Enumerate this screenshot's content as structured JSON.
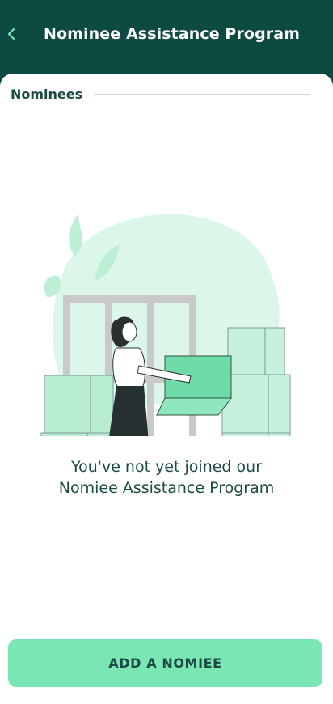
{
  "header": {
    "title": "Nominee Assistance Program",
    "back_icon": "chevron-left-icon"
  },
  "section": {
    "label": "Nominees"
  },
  "empty_state": {
    "illustration": "woman-carrying-box-illustration",
    "line1": "You've not yet joined our",
    "line2": "Nomiee Assistance Program"
  },
  "cta": {
    "label": "ADD A NOMIEE"
  },
  "colors": {
    "header_bg": "#0c4a42",
    "accent": "#79e6b4",
    "text_dark": "#1d4a44",
    "mint_light": "#cdf5e4"
  }
}
